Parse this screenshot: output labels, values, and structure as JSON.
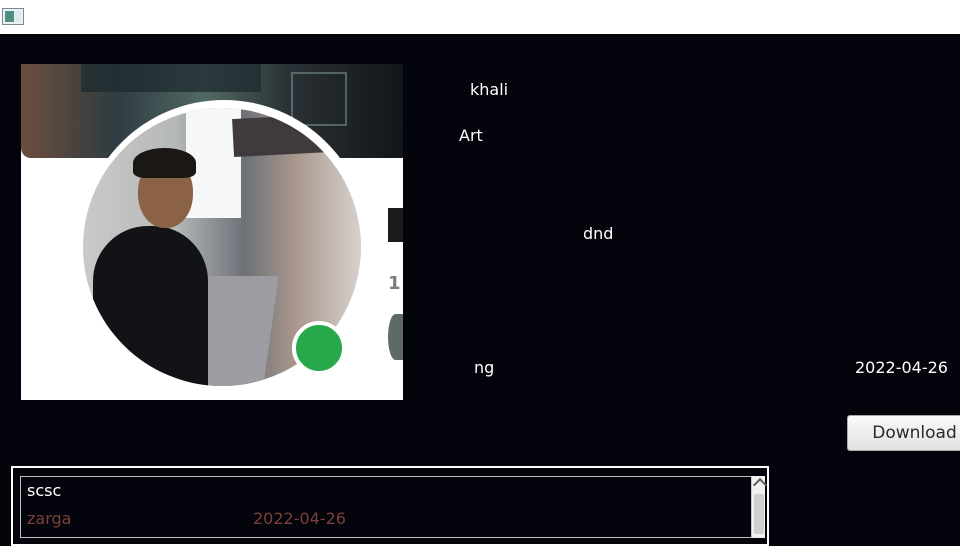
{
  "window": {
    "icon": "app-window-icon"
  },
  "profile": {
    "name": "khali",
    "category": "Art",
    "status": "dnd",
    "tag": "ng",
    "date": "2022-04-26",
    "status_color": "#27a84a"
  },
  "actions": {
    "download_label": "Download"
  },
  "list": {
    "items": [
      {
        "title": "scsc",
        "author": "zarga",
        "date": "2022-04-26"
      }
    ]
  },
  "colors": {
    "background": "#04040c",
    "accent_text": "#7d3f39",
    "button_face": "#eeeeee"
  }
}
